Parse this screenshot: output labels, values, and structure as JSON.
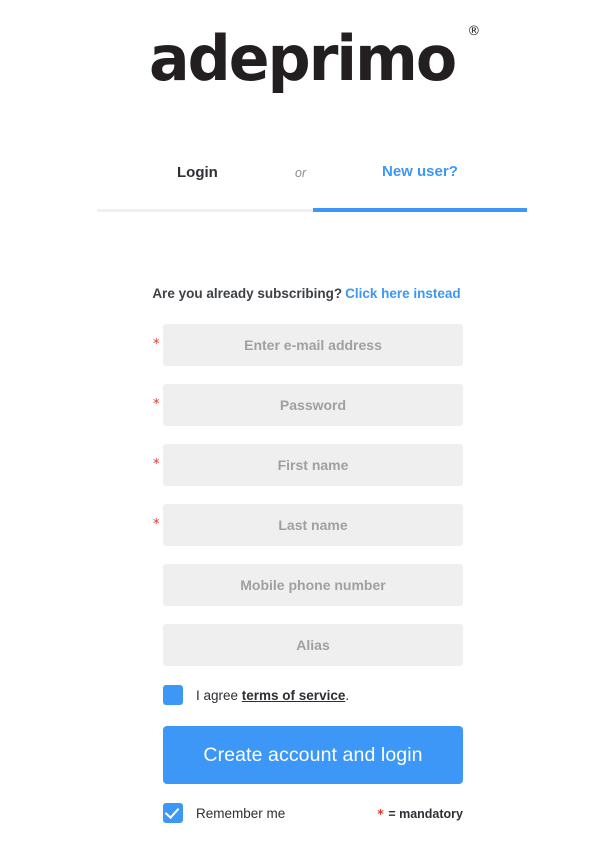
{
  "brand": {
    "logo_text": "adeprimo",
    "trademark_symbol": "®",
    "accent_color": "#3d97f7",
    "required_color": "#e8312b",
    "field_bg_color": "#efefef"
  },
  "tabs": {
    "login_label": "Login",
    "separator_label": "or",
    "new_user_label": "New user?",
    "active": "New user?"
  },
  "subheading": {
    "question": "Are you already subscribing?",
    "link_label": "Click here instead"
  },
  "form": {
    "fields": [
      {
        "name": "email",
        "placeholder": "Enter e-mail address",
        "value": "",
        "required": true,
        "required_marker": "*"
      },
      {
        "name": "password",
        "placeholder": "Password",
        "value": "",
        "required": true,
        "required_marker": "*"
      },
      {
        "name": "first_name",
        "placeholder": "First name",
        "value": "",
        "required": true,
        "required_marker": "*"
      },
      {
        "name": "last_name",
        "placeholder": "Last name",
        "value": "",
        "required": true,
        "required_marker": "*"
      },
      {
        "name": "mobile",
        "placeholder": "Mobile phone number",
        "value": "",
        "required": false,
        "required_marker": ""
      },
      {
        "name": "alias",
        "placeholder": "Alias",
        "value": "",
        "required": false,
        "required_marker": ""
      }
    ]
  },
  "agree": {
    "prefix": "I agree ",
    "terms_label": "terms of service",
    "suffix": ".",
    "checked": false
  },
  "submit": {
    "label": "Create account and login"
  },
  "footer": {
    "remember_label": "Remember me",
    "remember_checked": true,
    "mandatory_star": "*",
    "mandatory_label": "= mandatory"
  }
}
